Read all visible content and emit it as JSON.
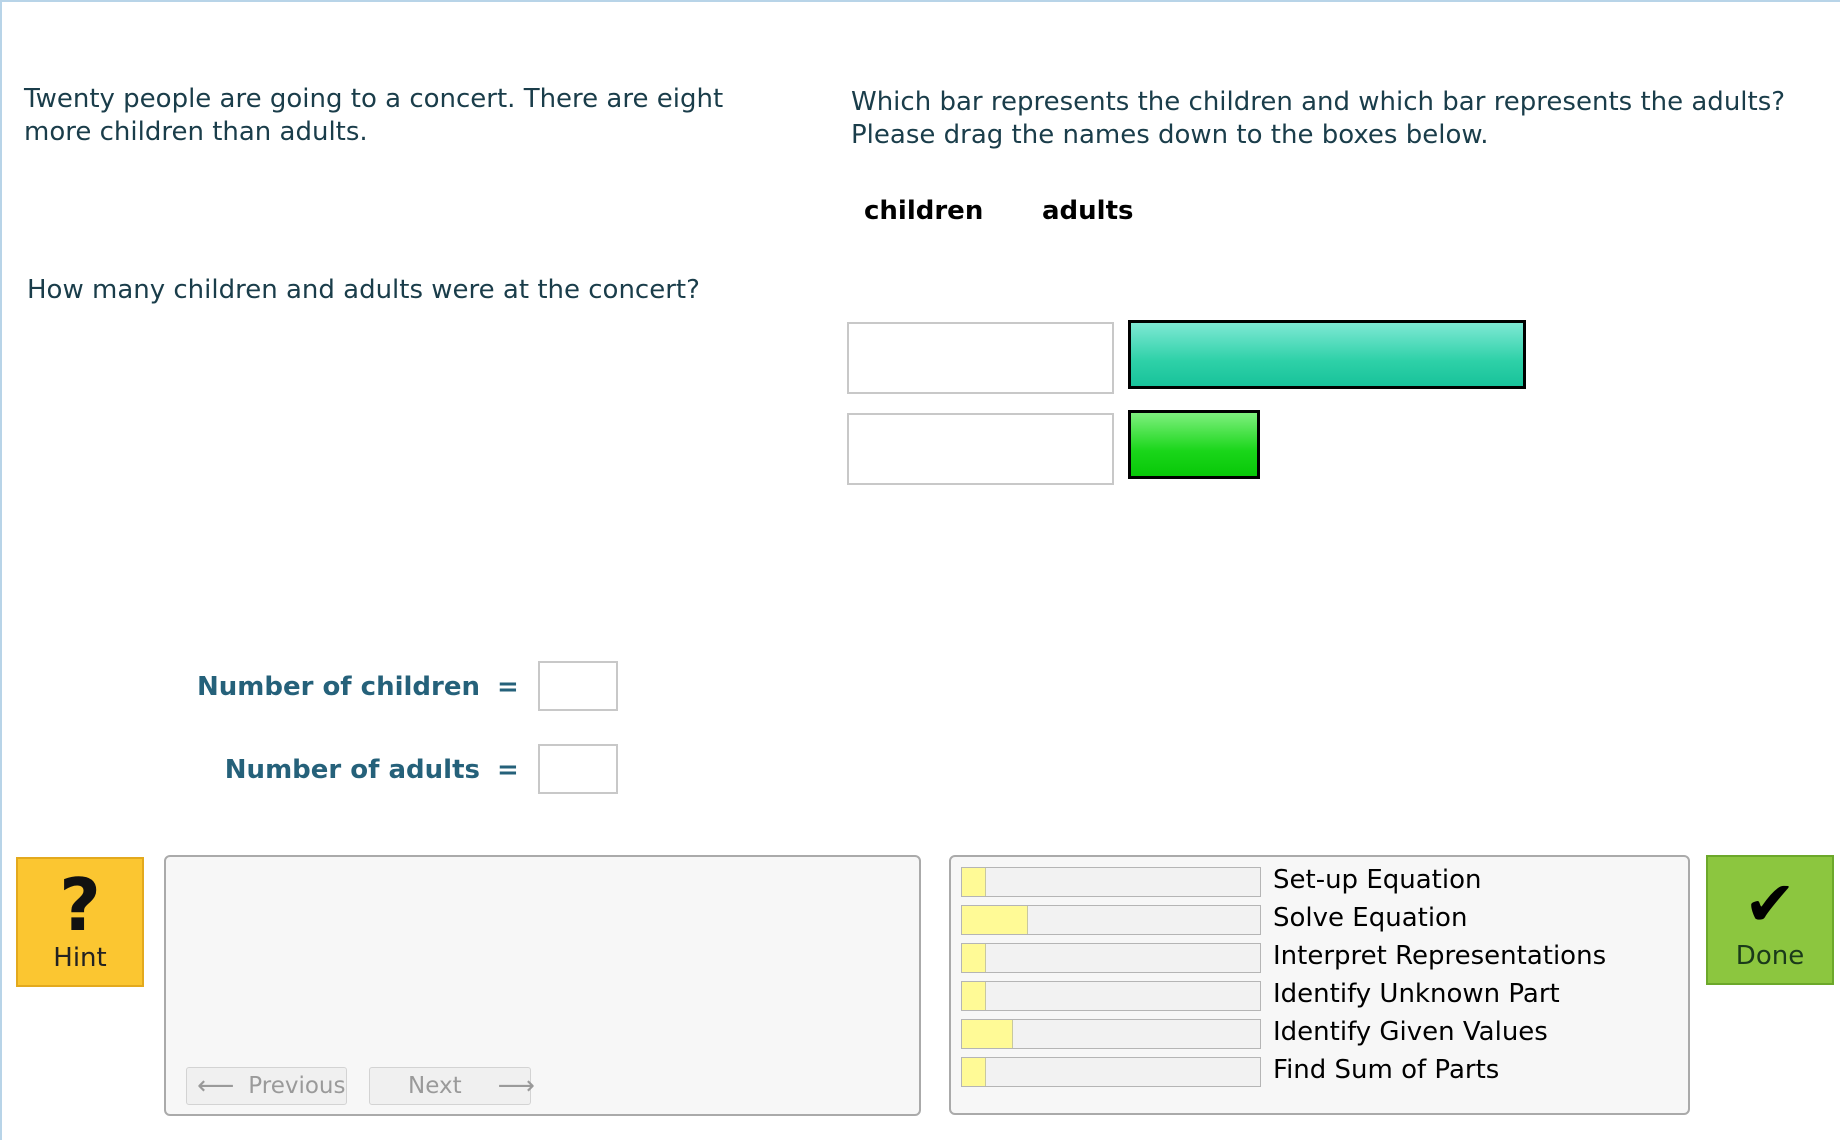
{
  "problem": {
    "text": "Twenty people are going to a concert. There are eight\nmore children than adults.",
    "question": "How many children and adults were at the concert?"
  },
  "instructions": "Which bar represents the children and which bar represents the adults?\nPlease drag the names down to the boxes below.",
  "drag_labels": [
    "children",
    "adults"
  ],
  "bars": [
    {
      "color": "#2ed1a8"
    },
    {
      "color": "#1ad61a"
    }
  ],
  "answers": {
    "children_label": "Number of children",
    "adults_label": "Number of adults",
    "equals": "=",
    "children_value": "",
    "adults_value": ""
  },
  "hint": {
    "label": "Hint",
    "icon": "question-mark-icon",
    "color": "#fbc631"
  },
  "navigation": {
    "previous": "Previous",
    "next": "Next"
  },
  "skills": [
    {
      "name": "Set-up Equation",
      "progress": 0.08
    },
    {
      "name": "Solve Equation",
      "progress": 0.22
    },
    {
      "name": "Interpret Representations",
      "progress": 0.08
    },
    {
      "name": "Identify Unknown Part",
      "progress": 0.08
    },
    {
      "name": "Identify Given Values",
      "progress": 0.17
    },
    {
      "name": "Find Sum of Parts",
      "progress": 0.08
    }
  ],
  "done": {
    "label": "Done",
    "icon": "checkmark-icon",
    "color": "#8cc63f"
  }
}
